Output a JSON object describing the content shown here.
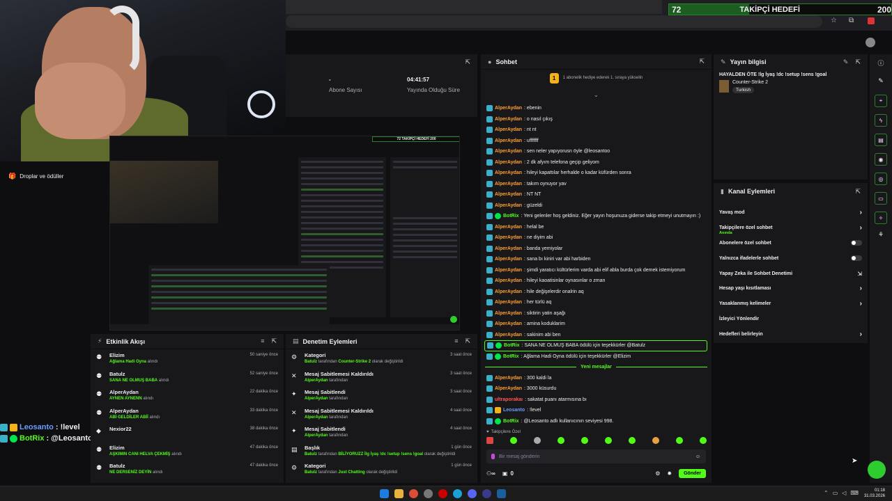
{
  "goal": {
    "current": "72",
    "label": "TAKİPÇİ HEDEFİ",
    "target": "200",
    "progress_fraction": 0.36
  },
  "sidebar": {
    "item1": "Droplar ve ödüller"
  },
  "stats": [
    {
      "value": "-",
      "label": "Abone Sayısı"
    },
    {
      "value": "04:41:57",
      "label": "Yayında Olduğu Süre"
    }
  ],
  "overlay_chat": [
    {
      "user": "Leosanto",
      "sep": " : ",
      "text": "!level"
    },
    {
      "user": "BotRix",
      "sep": " : ",
      "text": "@Leosanto adlı kullanıcının seviyesi 998."
    }
  ],
  "feed": {
    "title": "Etkinlik Akışı",
    "rows": [
      {
        "user": "Elizim",
        "action": "Ağlama Hadi Oyna",
        "suffix": " alındı",
        "time": "50 saniye önce"
      },
      {
        "user": "Batulz",
        "action": "SANA NE OLMUŞ BABA",
        "suffix": " alındı",
        "time": "52 saniye önce"
      },
      {
        "user": "AlperAydan",
        "action": "AYNEN AYNENN",
        "suffix": " alındı",
        "time": "22 dakika önce"
      },
      {
        "user": "AlperAydan",
        "action": "ABİ GELDİLER ABİİ",
        "suffix": " alındı",
        "time": "33 dakika önce"
      },
      {
        "user": "Nexior22",
        "action": "",
        "suffix": "",
        "time": "38 dakika önce"
      },
      {
        "user": "Elizim",
        "action": "AŞKIMIN CANI HELVA ÇEKMİŞ",
        "suffix": " alındı",
        "time": "47 dakika önce"
      },
      {
        "user": "Batulz",
        "action": "NE DERSENİZ DEYİN",
        "suffix": " alındı",
        "time": "47 dakika önce"
      }
    ]
  },
  "mod": {
    "title": "Denetim Eylemleri",
    "rows": [
      {
        "title": "Kategori",
        "by": "Batulz",
        "mid": " tarafından ",
        "hl": "Counter-Strike 2",
        "tail": " olarak değiştirildi",
        "time": "3 saat önce"
      },
      {
        "title": "Mesaj Sabitlemesi Kaldırıldı",
        "by": "AlperAydan",
        "mid": " tarafından",
        "hl": "",
        "tail": "",
        "time": "3 saat önce"
      },
      {
        "title": "Mesaj Sabitlendi",
        "by": "AlperAydan",
        "mid": " tarafından",
        "hl": "",
        "tail": "",
        "time": "3 saat önce"
      },
      {
        "title": "Mesaj Sabitlemesi Kaldırıldı",
        "by": "AlperAydan",
        "mid": " tarafından",
        "hl": "",
        "tail": "",
        "time": "4 saat önce"
      },
      {
        "title": "Mesaj Sabitlendi",
        "by": "AlperAydan",
        "mid": " tarafından",
        "hl": "",
        "tail": "",
        "time": "4 saat önce"
      },
      {
        "title": "Başlık",
        "by": "Batulz",
        "mid": " tarafından ",
        "hl": "BİLİYORUZZ İlg İyaş !dc !setup !sens !goal",
        "tail": " olarak değiştirildi",
        "time": "1 gün önce"
      },
      {
        "title": "Kategori",
        "by": "Batulz",
        "mid": " tarafından ",
        "hl": "Just Chatting",
        "tail": " olarak değiştirildi",
        "time": "1 gün önce"
      }
    ]
  },
  "chat": {
    "title": "Sohbet",
    "pinned": "1 abonelik hediye ederek 1. sıraya yükselin",
    "pinned_count": "1",
    "messages": [
      {
        "type": "u",
        "user": "AlperAydan",
        "text": ": ebenin"
      },
      {
        "type": "u",
        "user": "AlperAydan",
        "text": ": o nasıl çıkış"
      },
      {
        "type": "u",
        "user": "AlperAydan",
        "text": ": nt nt"
      },
      {
        "type": "u",
        "user": "AlperAydan",
        "text": ": ufffffff"
      },
      {
        "type": "u",
        "user": "AlperAydan",
        "text": ": sen neler yapıyorusn öyle @leosantoo"
      },
      {
        "type": "u",
        "user": "AlperAydan",
        "text": ": 2 dk afyım telefona geçip geliyom"
      },
      {
        "type": "u",
        "user": "AlperAydan",
        "text": ": hileyi kapattılar herhalde o kadar küfürden sonra"
      },
      {
        "type": "u",
        "user": "AlperAydan",
        "text": ": takım oynuyor yav"
      },
      {
        "type": "u",
        "user": "AlperAydan",
        "text": ": NT NT"
      },
      {
        "type": "u",
        "user": "AlperAydan",
        "text": ": güzeldi"
      },
      {
        "type": "b",
        "user": "BotRix",
        "text": ": Yeni gelenler hoş geldiniz. Eğer yayın hoşunuza giderse takip etmeyi unutmayın :)"
      },
      {
        "type": "u",
        "user": "AlperAydan",
        "text": ": helal be"
      },
      {
        "type": "u",
        "user": "AlperAydan",
        "text": ": ne diyim abi"
      },
      {
        "type": "u",
        "user": "AlperAydan",
        "text": ": banda yemiyolar"
      },
      {
        "type": "u",
        "user": "AlperAydan",
        "text": ": sana bı kiniri var abi harbiden"
      },
      {
        "type": "u",
        "user": "AlperAydan",
        "text": ": şimdi yaratıcı kültürlerim varda abi elif abla burda çok demek istemiyorum"
      },
      {
        "type": "u",
        "user": "AlperAydan",
        "text": ": hileyi kaoatisinlar oynasınlar o zman"
      },
      {
        "type": "u",
        "user": "AlperAydan",
        "text": ": hile değişelerdir onalrin aq"
      },
      {
        "type": "u",
        "user": "AlperAydan",
        "text": ": her türlü aq"
      },
      {
        "type": "u",
        "user": "AlperAydan",
        "text": ": siktirin yatin aşağı"
      },
      {
        "type": "u",
        "user": "AlperAydan",
        "text": ": amina koduklarim"
      },
      {
        "type": "u",
        "user": "AlperAydan",
        "text": ": sakinim abi ben"
      },
      {
        "type": "bh",
        "user": "BotRix",
        "text": ": SANA NE OLMUŞ BABA ödülü için teşekkürler @Batulz"
      },
      {
        "type": "b",
        "user": "BotRix",
        "text": ": Ağlama Hadi Oyna ödülü için teşekkürler @Elizim"
      },
      {
        "type": "div",
        "user": "",
        "text": "Yeni mesajlar"
      },
      {
        "type": "u",
        "user": "AlperAydan",
        "text": ": 300 kaldi la"
      },
      {
        "type": "u",
        "user": "AlperAydan",
        "text": ": 3000 küsurdu"
      },
      {
        "type": "r",
        "user": "ultraporakaı",
        "text": ": sakatat puanı atarmısına bı"
      },
      {
        "type": "l",
        "user": "Leosanto",
        "text": ": !level"
      },
      {
        "type": "b",
        "user": "BotRix",
        "text": ": @Leosanto adlı kullanıcının seviyesi 998."
      }
    ],
    "followers_label": "Takipçilere Özel",
    "input_placeholder": "Bir mesaj gönderin",
    "points": "0",
    "send_label": "Gönder"
  },
  "info": {
    "title": "Yayın bilgisi",
    "stream_title": "HAYALDEN ÖTE !lg İyaş !dc !setup !sens !goal",
    "category": "Counter-Strike 2",
    "tag": "Turkish"
  },
  "actions": {
    "title": "Kanal Eylemleri",
    "rows": [
      {
        "label": "Yavaş mod",
        "kind": "chev",
        "sub": ""
      },
      {
        "label": "Takipçilere özel sohbet",
        "kind": "chev",
        "sub": "Anında"
      },
      {
        "label": "Abonelere özel sohbet",
        "kind": "toggle",
        "sub": ""
      },
      {
        "label": "Yalnızca ifadelerle sohbet",
        "kind": "toggle",
        "sub": ""
      },
      {
        "label": "Yapay Zeka ile Sohbet Denetimi",
        "kind": "ext",
        "sub": ""
      },
      {
        "label": "Hesap yaşı kısıtlaması",
        "kind": "chev",
        "sub": ""
      },
      {
        "label": "Yasaklanmış kelimeler",
        "kind": "chev",
        "sub": ""
      },
      {
        "label": "İzleyici Yönlendir",
        "kind": "none",
        "sub": ""
      },
      {
        "label": "Hedefleri belirleyin",
        "kind": "chev",
        "sub": ""
      }
    ]
  },
  "clock": {
    "time": "01:18",
    "date": "31.03.2026"
  },
  "nested_goal": "72   TAKİPÇİ HEDEFİ   200"
}
